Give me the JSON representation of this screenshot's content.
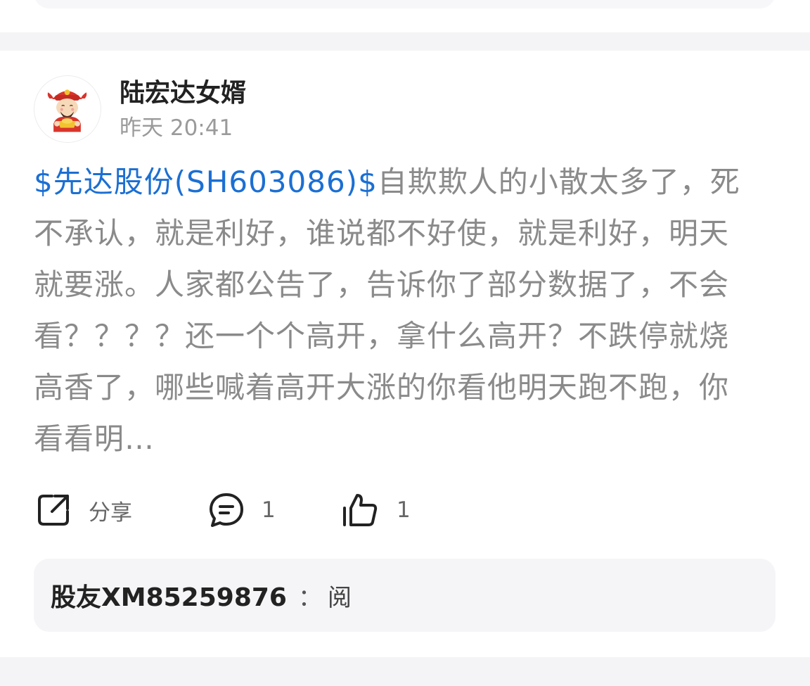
{
  "post": {
    "author": {
      "name": "陆宏达女婿",
      "avatar_icon": "god-of-wealth-avatar-icon"
    },
    "time": "昨天 20:41",
    "stock_link": "$先达股份(SH603086)$",
    "body_text": "自欺欺人的小散太多了，死不承认，就是利好，谁说都不好使，就是利好，明天就要涨。人家都公告了，告诉你了部分数据了，不会看？？？？还一个个高开，拿什么高开？不跌停就烧高香了，哪些喊着高开大涨的你看他明天跑不跑，你看看明…",
    "actions": {
      "share": {
        "icon": "share-icon",
        "label": "分享"
      },
      "comment": {
        "icon": "comment-icon",
        "count": "1"
      },
      "like": {
        "icon": "thumbs-up-icon",
        "count": "1"
      }
    },
    "comment_preview": {
      "user": "股友XM85259876",
      "separator": "：",
      "text": "阅"
    }
  },
  "colors": {
    "link": "#1b6fd3",
    "body_text": "#8a8a8a",
    "title_text": "#222222",
    "meta_text": "#9a9a9a",
    "page_bg": "#f4f4f6",
    "card_bg": "#ffffff"
  }
}
